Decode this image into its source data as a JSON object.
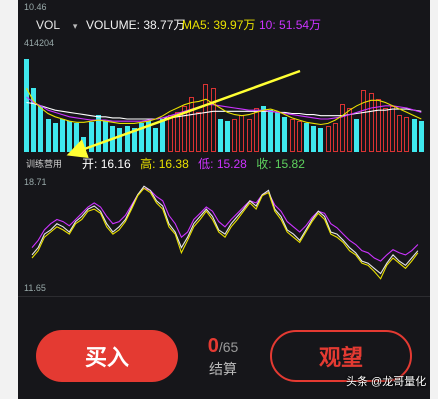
{
  "header": {
    "top_price": "10.46",
    "vol_label": "VOL",
    "dropdown_glyph": "▾",
    "volume_text": "VOLUME: 38.77万",
    "ma5_text": "MA5: 39.97万",
    "ma10_text": "10: 51.54万",
    "max_volume": "414204"
  },
  "volume_chart": {
    "bars": [
      {
        "h": 0.85,
        "c": "#3fe8ee"
      },
      {
        "h": 0.58,
        "c": "#3fe8ee"
      },
      {
        "h": 0.42,
        "c": "#3fe8ee"
      },
      {
        "h": 0.3,
        "c": "#3fe8ee"
      },
      {
        "h": 0.26,
        "c": "#3fe8ee"
      },
      {
        "h": 0.3,
        "c": "#3fe8ee"
      },
      {
        "h": 0.28,
        "c": "#3fe8ee"
      },
      {
        "h": 0.26,
        "c": "#3fe8ee"
      },
      {
        "h": 0.14,
        "c": "#3fe8ee"
      },
      {
        "h": 0.27,
        "c": "#3fe8ee"
      },
      {
        "h": 0.34,
        "c": "#3fe8ee"
      },
      {
        "h": 0.28,
        "c": "#3fe8ee"
      },
      {
        "h": 0.24,
        "c": "#3fe8ee"
      },
      {
        "h": 0.22,
        "c": "#3fe8ee"
      },
      {
        "h": 0.24,
        "c": "#3fe8ee"
      },
      {
        "h": 0.22,
        "c": "#3fe8ee"
      },
      {
        "h": 0.26,
        "c": "#3fe8ee"
      },
      {
        "h": 0.28,
        "c": "#3fe8ee"
      },
      {
        "h": 0.22,
        "c": "#3fe8ee"
      },
      {
        "h": 0.3,
        "c": "#3fe8ee"
      },
      {
        "h": 0.34,
        "c": "#d93333"
      },
      {
        "h": 0.36,
        "c": "#d93333"
      },
      {
        "h": 0.42,
        "c": "#d93333"
      },
      {
        "h": 0.5,
        "c": "#d93333"
      },
      {
        "h": 0.36,
        "c": "#d93333"
      },
      {
        "h": 0.62,
        "c": "#d93333"
      },
      {
        "h": 0.58,
        "c": "#d93333"
      },
      {
        "h": 0.3,
        "c": "#3fe8ee"
      },
      {
        "h": 0.28,
        "c": "#3fe8ee"
      },
      {
        "h": 0.3,
        "c": "#d93333"
      },
      {
        "h": 0.34,
        "c": "#d93333"
      },
      {
        "h": 0.3,
        "c": "#d93333"
      },
      {
        "h": 0.4,
        "c": "#d93333"
      },
      {
        "h": 0.42,
        "c": "#3fe8ee"
      },
      {
        "h": 0.38,
        "c": "#3fe8ee"
      },
      {
        "h": 0.36,
        "c": "#3fe8ee"
      },
      {
        "h": 0.32,
        "c": "#3fe8ee"
      },
      {
        "h": 0.3,
        "c": "#d93333"
      },
      {
        "h": 0.28,
        "c": "#d93333"
      },
      {
        "h": 0.26,
        "c": "#3fe8ee"
      },
      {
        "h": 0.24,
        "c": "#3fe8ee"
      },
      {
        "h": 0.22,
        "c": "#3fe8ee"
      },
      {
        "h": 0.24,
        "c": "#d93333"
      },
      {
        "h": 0.26,
        "c": "#d93333"
      },
      {
        "h": 0.44,
        "c": "#d93333"
      },
      {
        "h": 0.4,
        "c": "#d93333"
      },
      {
        "h": 0.3,
        "c": "#3fe8ee"
      },
      {
        "h": 0.56,
        "c": "#d93333"
      },
      {
        "h": 0.54,
        "c": "#d93333"
      },
      {
        "h": 0.48,
        "c": "#d93333"
      },
      {
        "h": 0.4,
        "c": "#d93333"
      },
      {
        "h": 0.42,
        "c": "#d93333"
      },
      {
        "h": 0.34,
        "c": "#d93333"
      },
      {
        "h": 0.32,
        "c": "#d93333"
      },
      {
        "h": 0.3,
        "c": "#3fe8ee"
      },
      {
        "h": 0.28,
        "c": "#3fe8ee"
      }
    ],
    "ma5": [
      0.58,
      0.46,
      0.4,
      0.35,
      0.32,
      0.3,
      0.28,
      0.27,
      0.27,
      0.28,
      0.29,
      0.28,
      0.27,
      0.26,
      0.26,
      0.26,
      0.27,
      0.28,
      0.3,
      0.33,
      0.37,
      0.4,
      0.43,
      0.45,
      0.46,
      0.48,
      0.44,
      0.4,
      0.36,
      0.34,
      0.33,
      0.34,
      0.36,
      0.38,
      0.39,
      0.37,
      0.34,
      0.31,
      0.29,
      0.27,
      0.26,
      0.25,
      0.26,
      0.29,
      0.33,
      0.38,
      0.42,
      0.45,
      0.47,
      0.47,
      0.45,
      0.42,
      0.39,
      0.36,
      0.33,
      0.3
    ],
    "ma10": [
      0.5,
      0.45,
      0.42,
      0.38,
      0.36,
      0.34,
      0.32,
      0.31,
      0.3,
      0.29,
      0.29,
      0.29,
      0.28,
      0.28,
      0.28,
      0.28,
      0.28,
      0.29,
      0.3,
      0.31,
      0.33,
      0.35,
      0.37,
      0.39,
      0.41,
      0.43,
      0.43,
      0.42,
      0.41,
      0.4,
      0.39,
      0.38,
      0.38,
      0.38,
      0.37,
      0.36,
      0.35,
      0.34,
      0.33,
      0.32,
      0.31,
      0.3,
      0.3,
      0.31,
      0.32,
      0.34,
      0.36,
      0.38,
      0.4,
      0.41,
      0.42,
      0.42,
      0.41,
      0.4,
      0.38,
      0.36
    ],
    "ma20": [
      0.45,
      0.44,
      0.42,
      0.4,
      0.38,
      0.37,
      0.36,
      0.35,
      0.34,
      0.33,
      0.32,
      0.32,
      0.31,
      0.31,
      0.3,
      0.3,
      0.3,
      0.3,
      0.3,
      0.31,
      0.31,
      0.32,
      0.33,
      0.34,
      0.35,
      0.36,
      0.37,
      0.37,
      0.37,
      0.37,
      0.37,
      0.37,
      0.37,
      0.37,
      0.37,
      0.36,
      0.36,
      0.35,
      0.35,
      0.34,
      0.34,
      0.33,
      0.33,
      0.33,
      0.33,
      0.34,
      0.35,
      0.36,
      0.37,
      0.38,
      0.38,
      0.39,
      0.39,
      0.39,
      0.38,
      0.37
    ]
  },
  "training_label": "训练营用",
  "ohlc": {
    "open_label": "开:",
    "open_value": "16.16",
    "high_label": "高:",
    "high_value": "16.38",
    "low_label": "低:",
    "low_value": "15.28",
    "close_label": "收:",
    "close_value": "15.82"
  },
  "price_chart": {
    "y_top_label": "18.71",
    "y_bottom_label": "11.65",
    "line_yellow": [
      0.25,
      0.32,
      0.45,
      0.5,
      0.55,
      0.52,
      0.48,
      0.58,
      0.62,
      0.7,
      0.72,
      0.68,
      0.55,
      0.48,
      0.52,
      0.6,
      0.72,
      0.85,
      0.92,
      0.88,
      0.78,
      0.72,
      0.55,
      0.48,
      0.3,
      0.42,
      0.55,
      0.62,
      0.7,
      0.62,
      0.5,
      0.45,
      0.55,
      0.62,
      0.7,
      0.78,
      0.72,
      0.85,
      0.88,
      0.7,
      0.62,
      0.5,
      0.45,
      0.4,
      0.5,
      0.6,
      0.68,
      0.62,
      0.48,
      0.45,
      0.4,
      0.32,
      0.28,
      0.2,
      0.18,
      0.12,
      0.05,
      0.18,
      0.25,
      0.2,
      0.15,
      0.22,
      0.3
    ],
    "line_white": [
      0.28,
      0.35,
      0.48,
      0.52,
      0.58,
      0.55,
      0.5,
      0.6,
      0.65,
      0.72,
      0.75,
      0.7,
      0.58,
      0.5,
      0.55,
      0.62,
      0.74,
      0.86,
      0.94,
      0.9,
      0.8,
      0.75,
      0.58,
      0.5,
      0.35,
      0.45,
      0.58,
      0.65,
      0.72,
      0.65,
      0.52,
      0.48,
      0.58,
      0.65,
      0.72,
      0.8,
      0.75,
      0.86,
      0.9,
      0.72,
      0.65,
      0.52,
      0.48,
      0.42,
      0.52,
      0.62,
      0.7,
      0.65,
      0.5,
      0.48,
      0.42,
      0.35,
      0.3,
      0.22,
      0.2,
      0.15,
      0.1,
      0.2,
      0.28,
      0.22,
      0.18,
      0.25,
      0.32
    ],
    "line_purple": [
      0.35,
      0.42,
      0.52,
      0.58,
      0.62,
      0.6,
      0.56,
      0.62,
      0.68,
      0.74,
      0.78,
      0.74,
      0.65,
      0.58,
      0.6,
      0.66,
      0.76,
      0.86,
      0.92,
      0.9,
      0.84,
      0.8,
      0.66,
      0.58,
      0.45,
      0.5,
      0.62,
      0.68,
      0.74,
      0.7,
      0.6,
      0.55,
      0.62,
      0.68,
      0.74,
      0.8,
      0.78,
      0.86,
      0.88,
      0.76,
      0.7,
      0.6,
      0.55,
      0.5,
      0.56,
      0.64,
      0.7,
      0.68,
      0.58,
      0.54,
      0.48,
      0.42,
      0.38,
      0.32,
      0.3,
      0.25,
      0.22,
      0.28,
      0.33,
      0.3,
      0.28,
      0.32,
      0.38
    ]
  },
  "counter": {
    "current": "0",
    "total": "/65",
    "label": "结算"
  },
  "buy_label": "买入",
  "watch_label": "观望",
  "watermark": "头条 @龙哥量化",
  "colors": {
    "accent_red": "#e43a32",
    "volume_up": "#d93333",
    "volume_down": "#3fe8ee",
    "ma5": "#e8e000",
    "ma10": "#cc33ff",
    "annotation_arrow": "#ffff33"
  }
}
